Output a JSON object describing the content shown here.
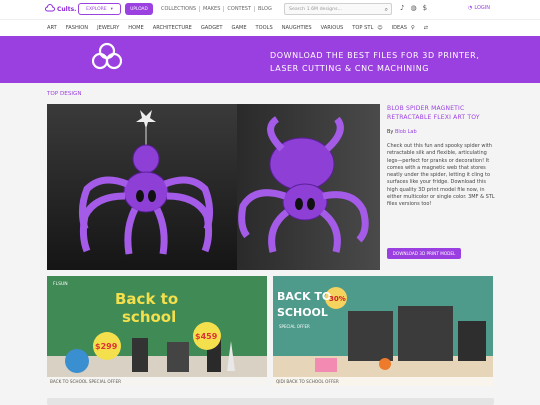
{
  "header": {
    "logo_text": "Cults.",
    "explore_label": "EXPLORE",
    "upload_label": "UPLOAD",
    "nav": [
      "COLLECTIONS",
      "MAKES",
      "CONTEST",
      "BLOG"
    ],
    "search_placeholder": "Search 1.6M designs...",
    "login_label": "LOGIN"
  },
  "categories": [
    "ART",
    "FASHION",
    "JEWELRY",
    "HOME",
    "ARCHITECTURE",
    "GADGET",
    "GAME",
    "TOOLS",
    "NAUGHTIES",
    "VARIOUS"
  ],
  "extra_links": [
    "TOP STL",
    "IDEAS"
  ],
  "banner": {
    "line1": "DOWNLOAD THE BEST FILES FOR 3D PRINTER,",
    "line2": "LASER CUTTING & CNC MACHINING"
  },
  "section_title": "TOP DESIGN",
  "featured": {
    "title": "BLOB SPIDER MAGNETIC RETRACTABLE FLEXI ART TOY",
    "author_prefix": "By",
    "author": "Blob Lab",
    "description": "Check out this fun and spooky spider with retractable silk and flexible, articulating legs—perfect for pranks or decoration! It comes with a magnetic web that stores neatly under the spider, letting it cling to surfaces like your fridge. Download this high quality 3D print model file now, in either multicolor or single color. 3MF & STL files versions too!",
    "button_label": "DOWNLOAD 3D PRINT MODEL"
  },
  "promos": [
    {
      "caption": "BACK TO SCHOOL SPECIAL OFFER",
      "brand": "FLSUN",
      "headline1": "Back to",
      "headline2": "school",
      "price1": "$299",
      "price2": "$459"
    },
    {
      "caption": "QIDI BACK TO SCHOOL OFFER",
      "headline1": "BACK TO",
      "headline2": "SCHOOL",
      "badge": "30%",
      "sub": "SPECIAL OFFER"
    }
  ],
  "colors": {
    "accent": "#9a41e0",
    "banner": "#9a3fe0"
  }
}
